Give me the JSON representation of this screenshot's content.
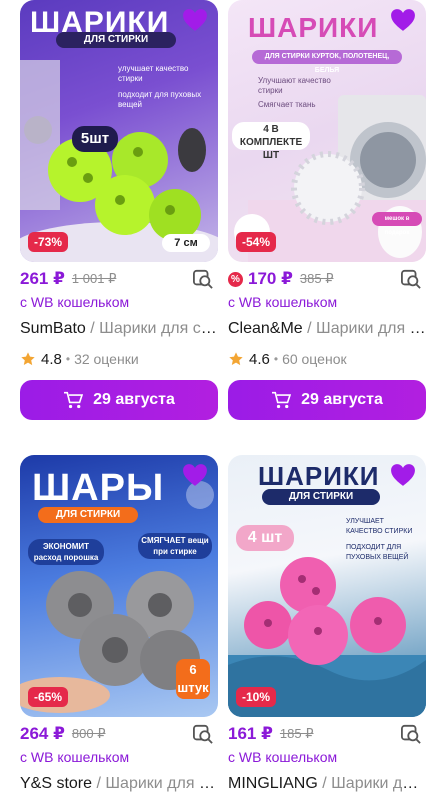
{
  "colors": {
    "accent": "#8b19d8",
    "discount": "#e5294a",
    "muted": "#8d8d8d"
  },
  "products": [
    {
      "image": {
        "headline": "ШАРИКИ",
        "subhead": "ДЛЯ СТИРКИ",
        "features": [
          "улучшает качество стирки",
          "подходит для пуховых вещей"
        ],
        "count_badge": "5шт",
        "size_badge": "7 см"
      },
      "discount": "-73%",
      "price": "261 ₽",
      "old_price": "1 001 ₽",
      "wallet": "с WB кошельком",
      "brand": "SumBato",
      "name": "Шарики для стирки",
      "rating": "4.8",
      "reviews": "32 оценки",
      "delivery": "29 августа"
    },
    {
      "image": {
        "headline": "ШАРИКИ",
        "subhead": "ДЛЯ СТИРКИ КУРТОК, ПОЛОТЕНЕЦ, БЕЛЬЯ",
        "features": [
          "Улучшают качество стирки",
          "Смягчает ткань"
        ],
        "count_badge": "4 В КОМПЛЕКТЕ ШТ",
        "gift_badge": "мешок в подарок"
      },
      "discount": "-54%",
      "price": "170 ₽",
      "old_price": "385 ₽",
      "wallet": "с WB кошельком",
      "brand": "Clean&Me",
      "name": "Шарики для стирки",
      "rating": "4.6",
      "reviews": "60 оценок",
      "delivery": "29 августа"
    },
    {
      "image": {
        "headline": "ШАРЫ",
        "subhead": "ДЛЯ СТИРКИ",
        "features": [
          "ЭКОНОМИТ расход порошка",
          "СМЯГЧАЕТ вещи при стирке"
        ],
        "count_badge": "6 штук"
      },
      "discount": "-65%",
      "price": "264 ₽",
      "old_price": "800 ₽",
      "wallet": "с WB кошельком",
      "brand": "Y&S store",
      "name": "Шарики для стирки"
    },
    {
      "image": {
        "headline": "ШАРИКИ",
        "subhead": "ДЛЯ СТИРКИ",
        "features": [
          "УЛУЧШАЕТ КАЧЕСТВО СТИРКИ",
          "ПОДХОДИТ ДЛЯ ПУХОВЫХ ВЕЩЕЙ"
        ],
        "count_badge": "4 шт"
      },
      "discount": "-10%",
      "price": "161 ₽",
      "old_price": "185 ₽",
      "wallet": "с WB кошельком",
      "brand": "MINGLIANG",
      "name": "Шарики для стирки"
    }
  ]
}
